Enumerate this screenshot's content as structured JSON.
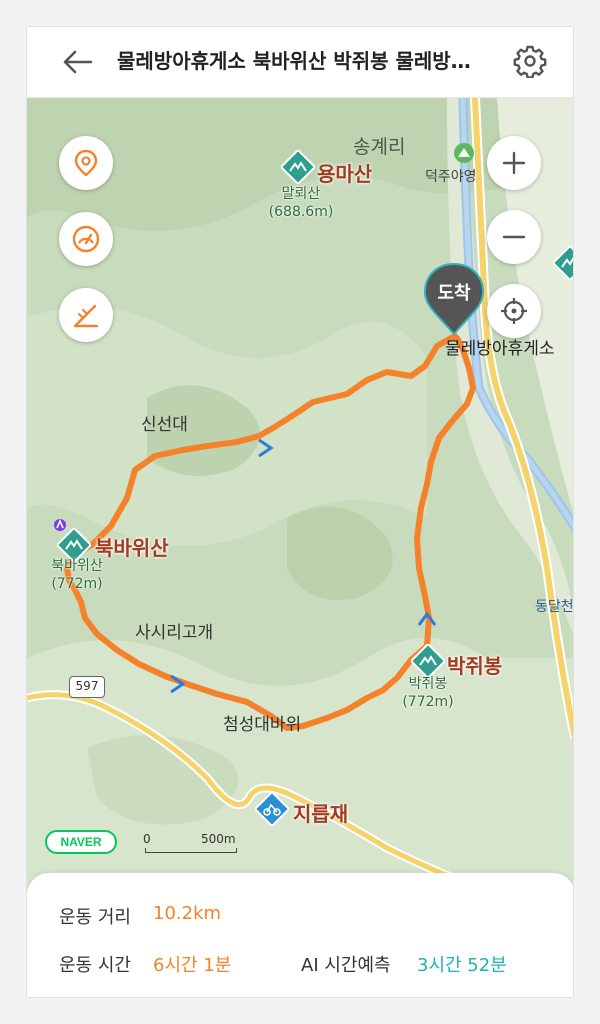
{
  "header": {
    "title": "물레방아휴게소 북바위산 박쥐봉 물레방아휴게소",
    "back_icon": "arrow-left-icon",
    "settings_icon": "gear-icon"
  },
  "map": {
    "place_labels": {
      "songgyeri": "송계리",
      "deokju_campsite": "덕주야영",
      "mullebanga_rest": "물레방아휴게소",
      "sinseondae": "신선대",
      "sasirigogae": "사시리고개",
      "cheomseongdaebawi": "첨성대바위",
      "dongdalcheon": "동달천",
      "road_number": "597"
    },
    "peaks": {
      "yongmasan": {
        "name": "용마산"
      },
      "malloesan": {
        "sub_name": "말뢰산",
        "elevation": "(688.6m)"
      },
      "bukbawisan": {
        "name": "북바위산",
        "sub_name": "북바위산",
        "elevation": "(772m)"
      },
      "bakjwibong": {
        "name": "박쥐봉",
        "sub_name": "박쥐봉",
        "elevation": "(772m)"
      },
      "jireupjae": {
        "name": "지릅재"
      }
    },
    "arrival_marker": {
      "label": "도착"
    },
    "scale": {
      "zero": "0",
      "distance": "500m"
    },
    "brand": "NAVER",
    "route_color": "#f5822a"
  },
  "controls": {
    "left": [
      {
        "name": "location-pin-button",
        "icon": "location-pin-icon"
      },
      {
        "name": "speedometer-button",
        "icon": "speedometer-icon"
      },
      {
        "name": "slope-button",
        "icon": "slope-icon"
      }
    ],
    "right": [
      {
        "name": "zoom-in-button",
        "icon": "plus-icon"
      },
      {
        "name": "zoom-out-button",
        "icon": "minus-icon"
      },
      {
        "name": "current-location-button",
        "icon": "crosshair-icon"
      }
    ]
  },
  "stats": {
    "distance_label": "운동 거리",
    "distance_value": "10.2km",
    "time_label": "운동 시간",
    "time_value": "6시간 1분",
    "ai_label": "AI 시간예측",
    "ai_value": "3시간 52분"
  },
  "colors": {
    "accent_orange": "#f5822a",
    "accent_teal": "#1eb3b8",
    "peak_text": "#a33a1e",
    "map_green": "#c9dcbd"
  }
}
